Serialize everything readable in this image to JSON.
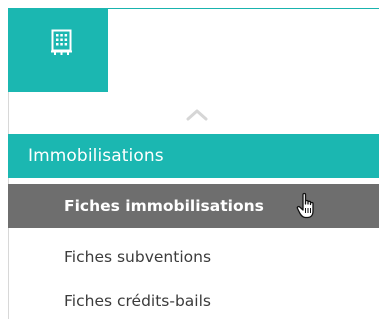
{
  "sidebar": {
    "logo_icon": "building-icon",
    "collapse_icon": "chevron-up-icon",
    "section": {
      "label": "Immobilisations"
    },
    "items": [
      {
        "label": "Fiches immobilisations",
        "active": true
      },
      {
        "label": "Fiches subventions",
        "active": false
      },
      {
        "label": "Fiches crédits-bails",
        "active": false
      }
    ]
  },
  "pointer": "hand-pointer-icon",
  "colors": {
    "accent": "#1bb7b1",
    "active_item": "#6e6e6e",
    "text": "#3c3c3c"
  }
}
